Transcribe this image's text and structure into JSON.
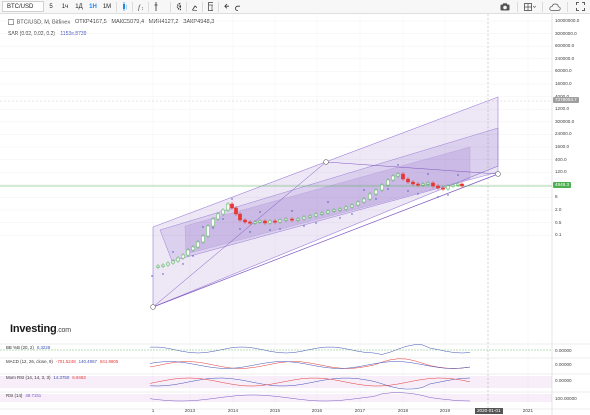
{
  "toolbar": {
    "symbol": "BTC/USD",
    "intervals": [
      "5",
      "1ч",
      "1Д",
      "1Н",
      "1M"
    ],
    "active_interval": "1Н",
    "icons": [
      "candles-icon",
      "indicators-icon",
      "compare-icon",
      "settings-icon",
      "chart-type-icon",
      "templates-icon",
      "undo-icon",
      "redo-icon"
    ],
    "right_icons": [
      "camera-icon",
      "layout-icon",
      "cloud-icon",
      "fullscreen-icon"
    ]
  },
  "legend": {
    "title": "BTC/USD, M, Bitfinex",
    "open": "ОТКР4167,5",
    "high": "МАКС5079,4",
    "low": "МИН4127,2",
    "close": "ЗАКР4948,3",
    "sar_label": "SAR (0.02, 0.02, 0.2)",
    "sar_value": "1153e.8739"
  },
  "price_axis": {
    "ticks": [
      "10000000.0",
      "3000000.0",
      "600000.0",
      "240000.0",
      "60000.0",
      "16000.0",
      "4000.0",
      "1200.0",
      "300000.0",
      "24000.0",
      "1600.0",
      "400.0",
      "120.0",
      "30",
      "8",
      "2.0",
      "0.5",
      "0.1"
    ],
    "tags": [
      {
        "text": "7378004.7",
        "color": "#9e9e9e"
      },
      {
        "text": "4948.3",
        "color": "#4caf50"
      }
    ]
  },
  "time_axis": {
    "ticks": [
      "1",
      "2013",
      "2014",
      "2015",
      "2016",
      "2017",
      "2018",
      "2019",
      "2020-01-01",
      "2021"
    ],
    "crosshair_label": "2020-01-01"
  },
  "indicators": [
    {
      "name": "BB %B (20, 2)",
      "values": [
        "0.3228"
      ],
      "colors": [
        "#3f51b5"
      ],
      "scale": [
        "0.00000"
      ]
    },
    {
      "name": "MACD (12, 26, close, 9)",
      "values": [
        "-701.5248",
        "140.4957",
        "841.9805"
      ],
      "colors": [
        "#e53935",
        "#3f51b5",
        "#e53935"
      ],
      "scale": [
        "0.00000"
      ]
    },
    {
      "name": "Mom RSI (14, 14, 3, 3)",
      "values": [
        "14.3750",
        "6.9463"
      ],
      "colors": [
        "#3f51b5",
        "#e53935"
      ],
      "scale": [
        "0.00000"
      ]
    },
    {
      "name": "RSI (14)",
      "values": [
        "49.7151"
      ],
      "colors": [
        "#7e57c2"
      ],
      "scale": [
        "100.00000"
      ]
    }
  ],
  "watermark": {
    "brand": "Investing",
    "suffix": ".com"
  },
  "colors": {
    "accent": "#1e88e5",
    "channel": "#7e57c2",
    "up": "#4caf50",
    "down": "#e53935",
    "price_line": "#4caf50"
  }
}
